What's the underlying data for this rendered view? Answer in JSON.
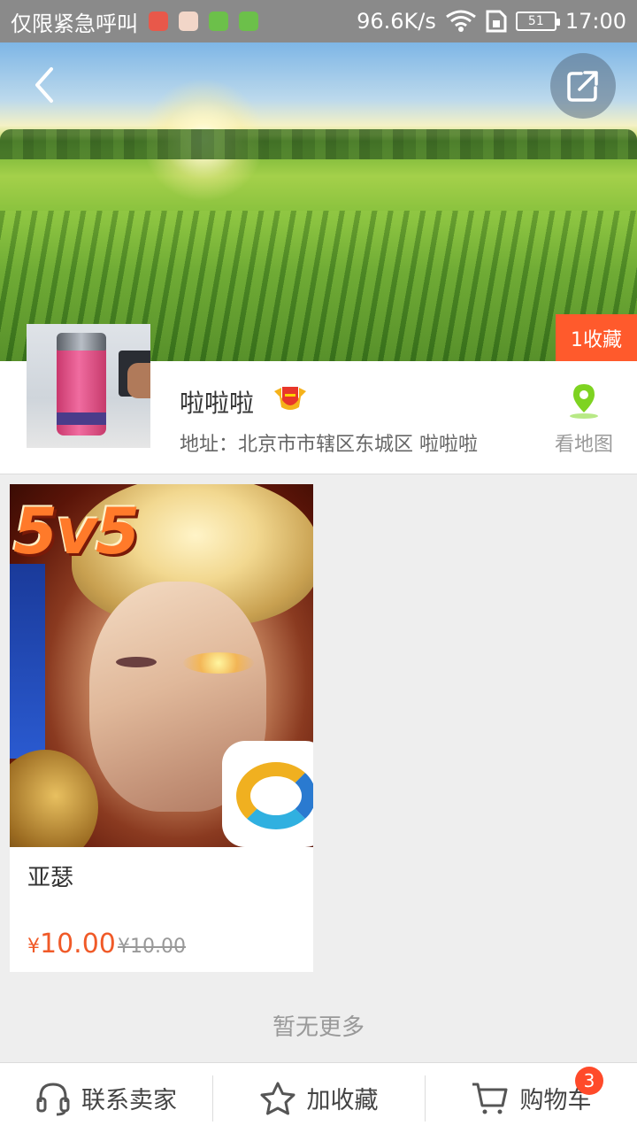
{
  "status_bar": {
    "carrier": "仅限紧急呼叫",
    "speed": "96.6K/s",
    "battery": "51",
    "time": "17:00"
  },
  "banner": {
    "favorites_badge": "1收藏"
  },
  "shop": {
    "name": "啦啦啦",
    "address": "地址：北京市市辖区东城区 啦啦啦",
    "map_label": "看地图"
  },
  "product": {
    "name": "亚瑟",
    "price": "10.00",
    "currency": "¥",
    "original_price": "¥10.00",
    "cover_text": "5v5"
  },
  "list_end_text": "暂无更多",
  "bottom_bar": {
    "contact_label": "联系卖家",
    "favorite_label": "加收藏",
    "cart_label": "购物车",
    "cart_count": "3"
  },
  "colors": {
    "accent": "#ff5a2c",
    "price": "#f05a28",
    "map_icon": "#7ed321"
  }
}
